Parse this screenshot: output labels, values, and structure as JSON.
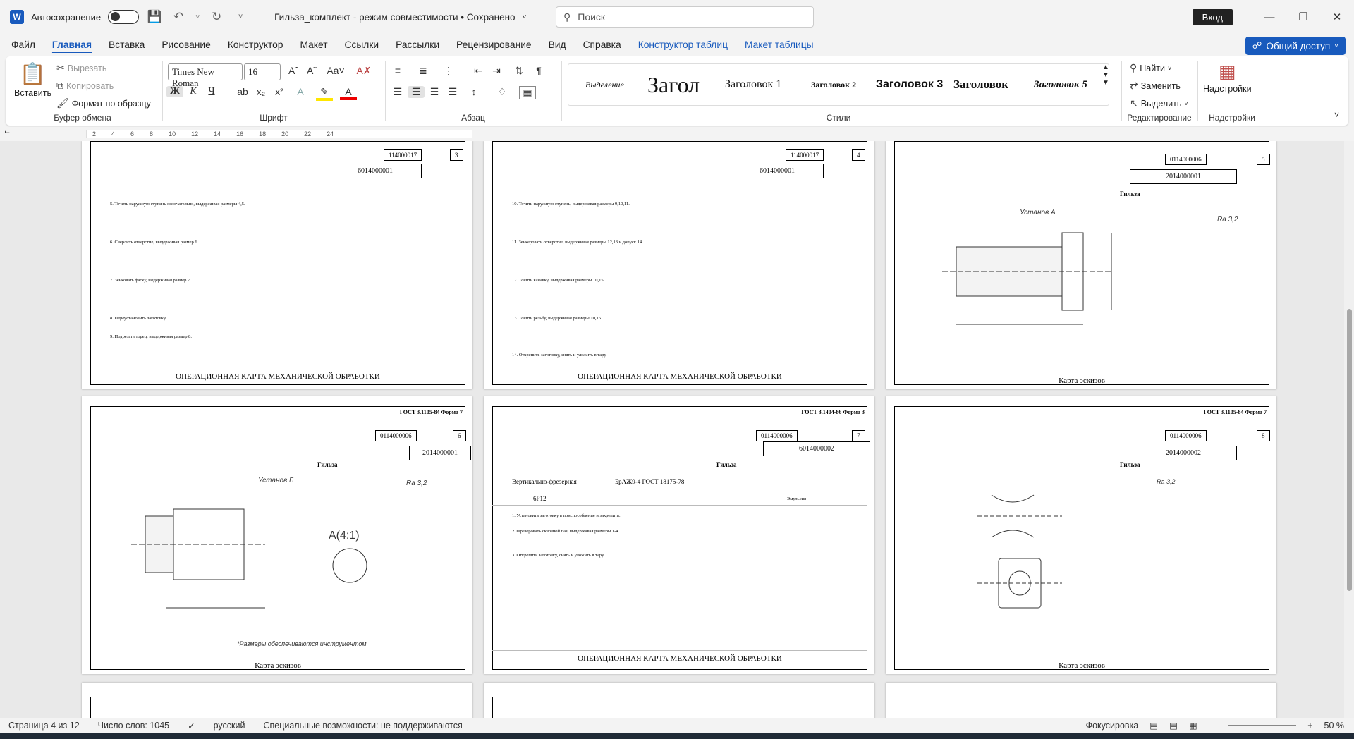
{
  "titlebar": {
    "app_logo": "W",
    "autosave_label": "Автосохранение",
    "doc_title": "Гильза_комплект - режим совместимости • Сохранено",
    "search_placeholder": "Поиск",
    "signin_label": "Вход"
  },
  "menu": [
    "Файл",
    "Главная",
    "Вставка",
    "Рисование",
    "Конструктор",
    "Макет",
    "Ссылки",
    "Рассылки",
    "Рецензирование",
    "Вид",
    "Справка",
    "Конструктор таблиц",
    "Макет таблицы"
  ],
  "share_label": "Общий доступ",
  "ribbon": {
    "clipboard": {
      "paste": "Вставить",
      "cut": "Вырезать",
      "copy": "Копировать",
      "format_painter": "Формат по образцу",
      "label": "Буфер обмена"
    },
    "font": {
      "name": "Times New Roman",
      "size": "16",
      "label": "Шрифт",
      "bold": "Ж",
      "italic": "К",
      "underline": "Ч",
      "strike": "ab",
      "sub": "x₂",
      "sup": "x²"
    },
    "paragraph": {
      "label": "Абзац"
    },
    "styles": {
      "label": "Стили",
      "items": [
        "Выделение",
        "Загол",
        "Заголовок 1",
        "Заголовок 2",
        "Заголовок 3",
        "Заголовок",
        "Заголовок 5"
      ]
    },
    "editing": {
      "find": "Найти",
      "replace": "Заменить",
      "select": "Выделить",
      "label": "Редактирование"
    },
    "addins": {
      "btn": "Надстройки",
      "label": "Надстройки"
    }
  },
  "ruler_ticks": [
    "2",
    "4",
    "6",
    "8",
    "10",
    "12",
    "14",
    "16",
    "18",
    "20",
    "22",
    "24"
  ],
  "pages": [
    {
      "num": "114000017",
      "doc": "6014000001",
      "sheet": "3",
      "title": "ОПЕРАЦИОННАЯ КАРТА МЕХАНИЧЕСКОЙ ОБРАБОТКИ",
      "ops": [
        "5. Точить наружную ступень окончательно, выдерживая размеры 4,5.",
        "6. Сверлить отверстие, выдерживая размер 6.",
        "7. Зенковать фаску, выдерживая размер 7.",
        "8. Переустановить заготовку.",
        "9. Подрезать торец, выдерживая размер 8."
      ]
    },
    {
      "num": "114000017",
      "doc": "6014000001",
      "sheet": "4",
      "title": "ОПЕРАЦИОННАЯ КАРТА МЕХАНИЧЕСКОЙ ОБРАБОТКИ",
      "ops": [
        "10. Точить наружную ступень, выдерживая размеры 9,10,11.",
        "11. Зенкеровать отверстие, выдерживая размеры 12,13 и допуск 14.",
        "12. Точить канавку, выдерживая размеры 10,15.",
        "13. Точить резьбу, выдерживая размеры 10,16.",
        "14. Открепить заготовку, снять и уложить в тару."
      ]
    },
    {
      "num": "0114000006",
      "doc": "2014000001",
      "sheet": "5",
      "title": "Карта эскизов",
      "part": "Гильза",
      "setup": "Установ А",
      "ra": "Ra 3,2"
    },
    {
      "num": "0114000006",
      "doc": "2014000001",
      "sheet": "6",
      "title": "Карта эскизов",
      "part": "Гильза",
      "setup": "Установ Б",
      "ra": "Ra 3,2",
      "note": "*Размеры обеспечиваются инструментом",
      "gost": "ГОСТ 3.1105-84    Форма 7"
    },
    {
      "num": "0114000006",
      "doc": "6014000002",
      "sheet": "7",
      "title": "ОПЕРАЦИОННАЯ КАРТА МЕХАНИЧЕСКОЙ ОБРАБОТКИ",
      "part": "Гильза",
      "operation": "Вертикально-фрезерная",
      "material": "БрАЖ9-4 ГОСТ 18175-78",
      "machine": "6Р12",
      "coolant": "Эмульсия",
      "gost": "ГОСТ 3.1404-86    Форма 3",
      "ops": [
        "1. Установить заготовку в приспособление и закрепить.",
        "2. Фрезеровать сквозной паз, выдерживая размеры 1-4.",
        "3. Открепить заготовку, снять и уложить в тару."
      ]
    },
    {
      "num": "0114000006",
      "doc": "2014000002",
      "sheet": "8",
      "title": "Карта эскизов",
      "part": "Гильза",
      "ra": "Ra 3,2",
      "gost": "ГОСТ 3.1105-84    Форма 7"
    }
  ],
  "status": {
    "page": "Страница 4 из 12",
    "words": "Число слов: 1045",
    "lang": "русский",
    "accessibility": "Специальные возможности: не поддерживаются",
    "focus": "Фокусировка",
    "zoom": "50 %"
  }
}
